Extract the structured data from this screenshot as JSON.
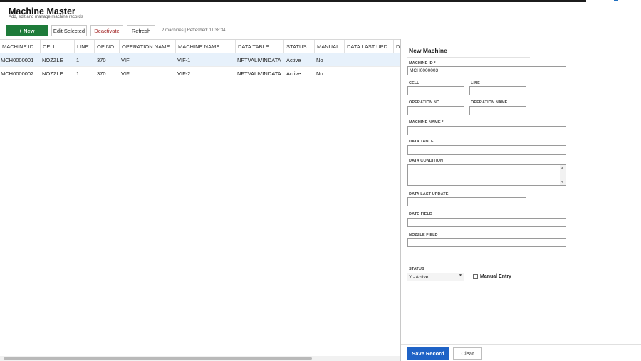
{
  "header": {
    "title": "Machine Master",
    "subtitle": "Add, edit and manage machine records"
  },
  "toolbar": {
    "new_label": "+ New",
    "edit_label": "Edit Selected",
    "deactivate_label": "Deactivate",
    "refresh_label": "Refresh",
    "info": "2 machines | Refreshed: 11:38:34"
  },
  "grid": {
    "columns": [
      "MACHINE ID",
      "CELL",
      "LINE",
      "OP NO",
      "OPERATION NAME",
      "MACHINE NAME",
      "DATA TABLE",
      "STATUS",
      "MANUAL",
      "DATA LAST UPD",
      "D"
    ],
    "rows": [
      [
        "MCH0000001",
        "NOZZLE",
        "1",
        "370",
        "VIF",
        "VIF-1",
        "NFTVALIVINDATA",
        "Active",
        "No",
        "",
        ""
      ],
      [
        "MCH0000002",
        "NOZZLE",
        "1",
        "370",
        "VIF",
        "VIF-2",
        "NFTVALIVINDATA",
        "Active",
        "No",
        "",
        ""
      ]
    ]
  },
  "form": {
    "title": "New Machine",
    "labels": {
      "machine_id": "MACHINE ID *",
      "cell": "CELL",
      "line": "LINE",
      "operation_no": "OPERATION NO",
      "operation_name": "OPERATION NAME",
      "machine_name": "MACHINE NAME *",
      "data_table": "DATA TABLE",
      "data_condition": "DATA CONDITION",
      "data_last_update": "DATA LAST UPDATE",
      "date_field": "DATE FIELD",
      "nozzle_field": "NOZZLE FIELD",
      "status": "STATUS"
    },
    "values": {
      "machine_id": "MCH0000003",
      "cell": "",
      "line": "",
      "operation_no": "",
      "operation_name": "",
      "machine_name": "",
      "data_table": "",
      "data_condition": "",
      "data_last_update": "",
      "date_field": "",
      "nozzle_field": "",
      "status": "Y - Active"
    },
    "manual_entry_label": "Manual Entry",
    "manual_entry_checked": false,
    "save_label": "Save Record",
    "clear_label": "Clear"
  },
  "colors": {
    "new_button": "#1e7b3a",
    "save_button": "#1f63c6",
    "selected_row": "#e7f1fb",
    "deactivate_text": "#a02020"
  },
  "icons": {
    "select_arrow": "chevron-down-icon",
    "scroll_up": "scroll-up-icon",
    "scroll_down": "scroll-down-icon"
  }
}
